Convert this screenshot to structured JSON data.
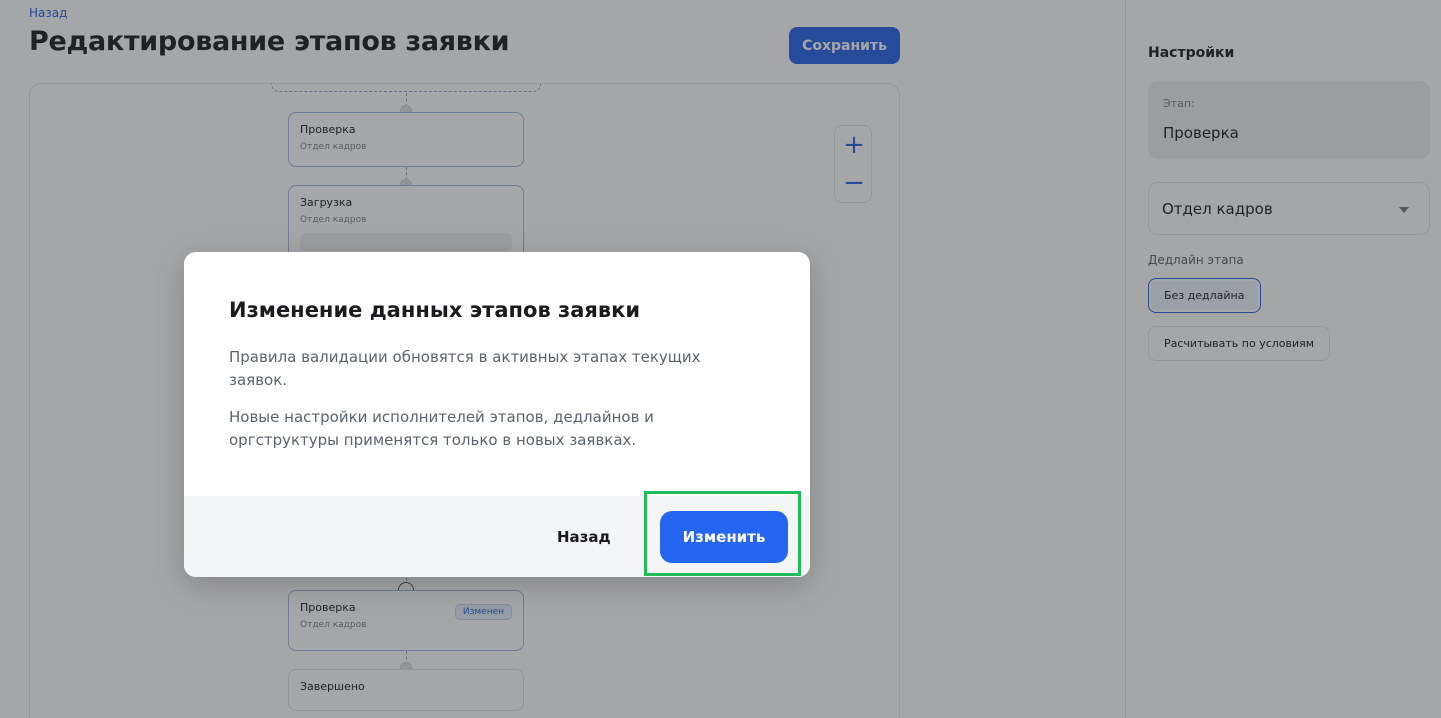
{
  "header": {
    "back_label": "Назад",
    "title": "Редактирование этапов заявки",
    "save_label": "Сохранить"
  },
  "canvas": {
    "stages": [
      {
        "name": "Проверка",
        "dept": "Отдел кадров"
      },
      {
        "name": "Загрузка",
        "dept": "Отдел кадров"
      },
      {
        "name": "Проверка",
        "dept": "Отдел кадров",
        "badge": "Изменен"
      },
      {
        "name": "Завершено"
      }
    ],
    "zoom_in_symbol": "+",
    "zoom_out_symbol": "−"
  },
  "sidebar": {
    "title": "Настройки",
    "stage_label": "Этап:",
    "stage_value": "Проверка",
    "department_value": "Отдел кадров",
    "deadline_label": "Дедлайн этапа",
    "deadline_options": [
      "Без дедлайна",
      "Расчитывать по условиям"
    ]
  },
  "modal": {
    "title": "Изменение данных этапов заявки",
    "paragraph_1": "Правила валидации обновятся в активных этапах текущих заявок.",
    "paragraph_2": "Новые настройки исполнителей этапов, дедлайнов и оргструктуры применятся только в новых заявках.",
    "back_label": "Назад",
    "confirm_label": "Изменить"
  },
  "colors": {
    "accent": "#2563eb",
    "highlight": "#1fbd5a"
  }
}
